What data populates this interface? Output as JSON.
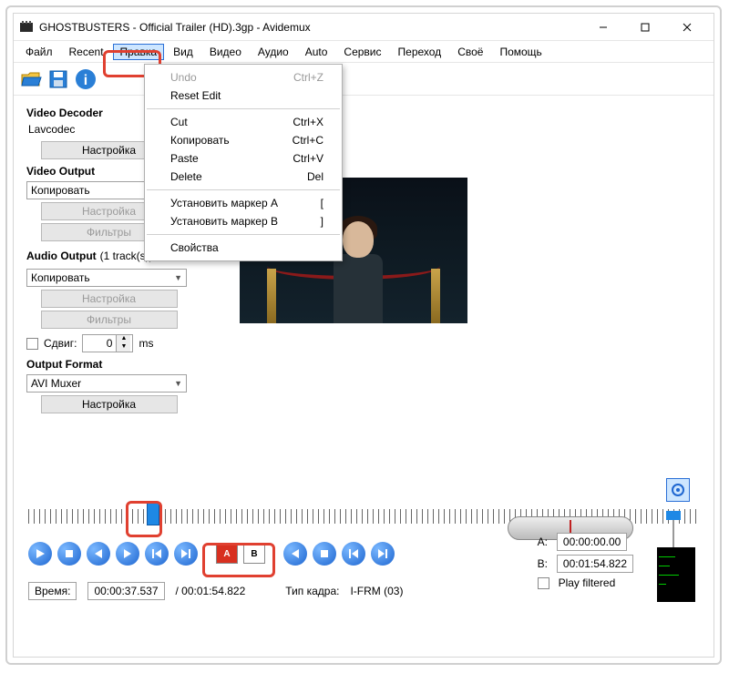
{
  "title": "GHOSTBUSTERS - Official Trailer (HD).3gp - Avidemux",
  "menubar": [
    "Файл",
    "Recent",
    "Правка",
    "Вид",
    "Видео",
    "Аудио",
    "Auto",
    "Сервис",
    "Переход",
    "Своё",
    "Помощь"
  ],
  "active_menu_index": 2,
  "dropdown": {
    "items": [
      {
        "label": "Undo",
        "accel": "Ctrl+Z",
        "disabled": true
      },
      {
        "label": "Reset Edit",
        "accel": ""
      },
      {
        "sep": true
      },
      {
        "label": "Cut",
        "accel": "Ctrl+X"
      },
      {
        "label": "Копировать",
        "accel": "Ctrl+C"
      },
      {
        "label": "Paste",
        "accel": "Ctrl+V"
      },
      {
        "label": "Delete",
        "accel": "Del"
      },
      {
        "sep": true
      },
      {
        "label": "Установить маркер A",
        "accel": "["
      },
      {
        "label": "Установить маркер B",
        "accel": "]"
      },
      {
        "sep": true
      },
      {
        "label": "Свойства",
        "accel": ""
      }
    ]
  },
  "left": {
    "video_decoder_title": "Video Decoder",
    "decoder_value": "Lavcodec",
    "configure": "Настройка",
    "video_output_title": "Video Output",
    "video_output_value": "Копировать",
    "filters": "Фильтры",
    "audio_output_title": "Audio Output",
    "audio_tracks": "(1 track(s))",
    "audio_output_value": "Копировать",
    "shift_label": "Сдвиг:",
    "shift_value": "0",
    "shift_unit": "ms",
    "output_format_title": "Output Format",
    "output_format_value": "AVI Muxer"
  },
  "bottom": {
    "time_label": "Время:",
    "time_value": "00:00:37.537",
    "duration": "/ 00:01:54.822",
    "frame_type_label": "Тип кадра:",
    "frame_type_value": "I-FRM (03)",
    "marker_a_label": "A:",
    "marker_a_value": "00:00:00.00",
    "marker_b_label": "B:",
    "marker_b_value": "00:01:54.822",
    "play_filtered": "Play filtered",
    "marker_a_btn": "A",
    "marker_b_btn": "B"
  }
}
